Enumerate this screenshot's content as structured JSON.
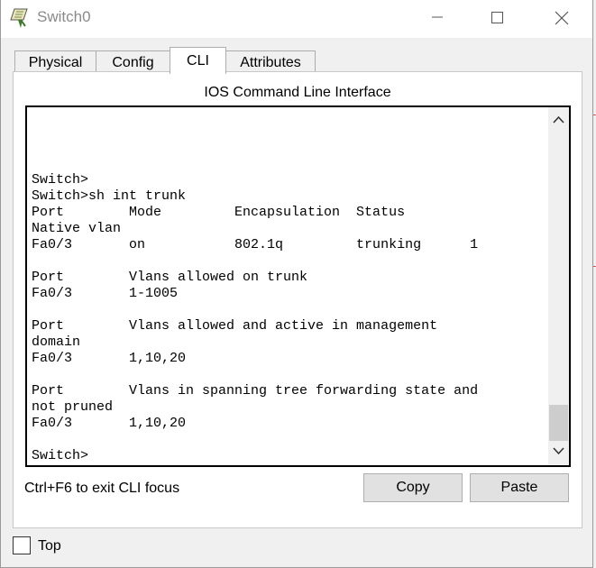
{
  "window": {
    "title": "Switch0"
  },
  "tabs": [
    {
      "label": "Physical",
      "active": false
    },
    {
      "label": "Config",
      "active": false
    },
    {
      "label": "CLI",
      "active": true
    },
    {
      "label": "Attributes",
      "active": false
    }
  ],
  "panel": {
    "heading": "IOS Command Line Interface"
  },
  "terminal": {
    "lines": [
      "Switch>",
      "Switch>sh int trunk",
      "Port        Mode         Encapsulation  Status",
      "Native vlan",
      "Fa0/3       on           802.1q         trunking      1",
      "",
      "Port        Vlans allowed on trunk",
      "Fa0/3       1-1005",
      "",
      "Port        Vlans allowed and active in management",
      "domain",
      "Fa0/3       1,10,20",
      "",
      "Port        Vlans in spanning tree forwarding state and",
      "not pruned",
      "Fa0/3       1,10,20",
      "",
      "Switch>"
    ]
  },
  "footer": {
    "hint": "Ctrl+F6 to exit CLI focus",
    "copy_label": "Copy",
    "paste_label": "Paste"
  },
  "top_option": {
    "label": "Top",
    "checked": false
  },
  "icons": {
    "app": "switch-app-icon",
    "minimize": "minimize-icon",
    "maximize": "maximize-icon",
    "close": "close-icon",
    "scroll_up": "chevron-up-icon",
    "scroll_down": "chevron-down-icon"
  }
}
